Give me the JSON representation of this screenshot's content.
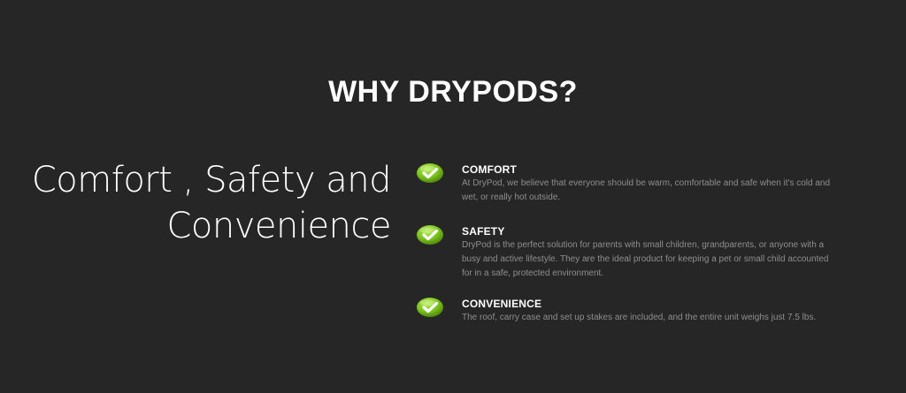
{
  "section": {
    "title": "WHY DRYPODS?"
  },
  "tagline": {
    "line1": "Comfort , Safety and",
    "line2": "Convenience"
  },
  "features": [
    {
      "icon": "checkmark-icon",
      "title": "COMFORT",
      "text": "At DryPod, we believe that everyone should be warm, comfortable and safe when it's cold and wet, or really hot outside."
    },
    {
      "icon": "checkmark-icon",
      "title": "SAFETY",
      "text": "DryPod is the perfect solution for parents with small children, grandparents, or anyone with a busy and active lifestyle. They are the ideal product for keeping a pet or small child accounted for in a safe, protected environment."
    },
    {
      "icon": "checkmark-icon",
      "title": "CONVENIENCE",
      "text": "The roof, carry case and set up stakes are included, and the entire unit weighs just 7.5 lbs."
    }
  ],
  "colors": {
    "background": "#262626",
    "heading": "#ffffff",
    "body_text": "#8e8e8e",
    "check_green": "#7cc31f"
  }
}
